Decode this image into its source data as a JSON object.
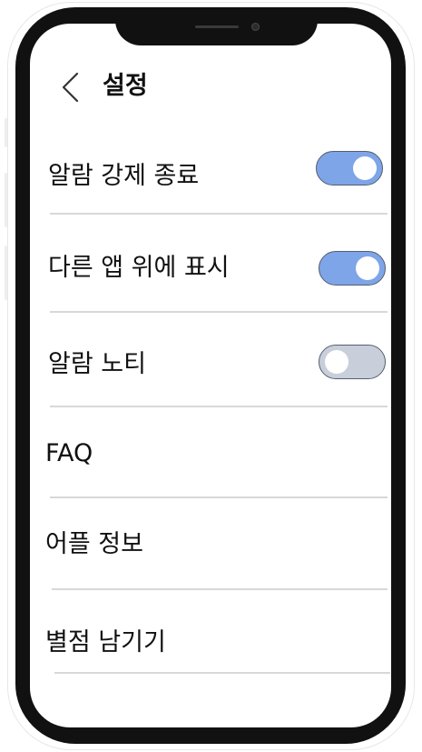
{
  "header": {
    "back_icon": "chevron-left-icon",
    "title": "설정"
  },
  "settings": {
    "alarm_force_quit": {
      "label": "알람 강제 종료",
      "enabled": true
    },
    "display_over_apps": {
      "label": "다른 앱 위에 표시",
      "enabled": true
    },
    "alarm_notification": {
      "label": "알람 노티",
      "enabled": false
    },
    "faq": {
      "label": "FAQ"
    },
    "app_info": {
      "label": "어플 정보"
    },
    "leave_rating": {
      "label": "별점 남기기"
    }
  },
  "colors": {
    "toggle_on": "#7ea5e8",
    "toggle_off": "#c9cfda",
    "divider": "#d8d8d8",
    "device_frame": "#111111"
  }
}
